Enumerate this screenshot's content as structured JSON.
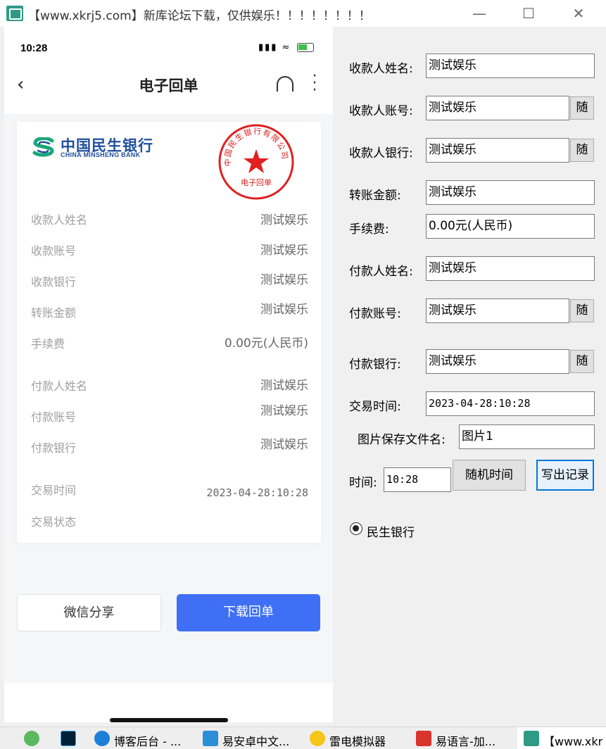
{
  "window": {
    "title": "【www.xkrj5.com】新库论坛下载，仅供娱乐！！！！！！！！",
    "minimize_icon": "minimize-icon",
    "maximize_icon": "maximize-icon",
    "close_icon": "close-icon"
  },
  "phone": {
    "status_time": "10:28",
    "page_title": "电子回单",
    "bank_name_cn": "中国民生银行",
    "bank_name_en": "CHINA MINSHENG BANK",
    "seal_text": "中国民生银行有限公司",
    "seal_subtext": "电子回单",
    "receipt_rows": [
      {
        "label": "收款人姓名",
        "value": "测试娱乐"
      },
      {
        "label": "收款账号",
        "value": "测试娱乐"
      },
      {
        "label": "收款银行",
        "value": "测试娱乐"
      },
      {
        "label": "转账金额",
        "value": "测试娱乐"
      },
      {
        "label": "手续费",
        "value": "0.00元(人民币)"
      },
      {
        "label": "付款人姓名",
        "value": "测试娱乐"
      },
      {
        "label": "付款账号",
        "value": "测试娱乐"
      },
      {
        "label": "付款银行",
        "value": "测试娱乐"
      },
      {
        "label": "交易时间",
        "value": "2023-04-28:10:28"
      },
      {
        "label": "交易状态",
        "value": ""
      }
    ],
    "share_button": "微信分享",
    "download_button": "下载回单"
  },
  "form": {
    "payee_name": {
      "label": "收款人姓名:",
      "value": "测试娱乐"
    },
    "payee_account": {
      "label": "收款人账号:",
      "value": "测试娱乐",
      "random": "随"
    },
    "payee_bank": {
      "label": "收款人银行:",
      "value": "测试娱乐",
      "random": "随"
    },
    "amount": {
      "label": "转账金额:",
      "value": "测试娱乐"
    },
    "fee": {
      "label": "手续费:",
      "value": "0.00元(人民币)"
    },
    "payer_name": {
      "label": "付款人姓名:",
      "value": "测试娱乐"
    },
    "payer_account": {
      "label": "付款账号:",
      "value": "测试娱乐",
      "random": "随"
    },
    "payer_bank": {
      "label": "付款银行:",
      "value": "测试娱乐",
      "random": "随"
    },
    "trade_time": {
      "label": "交易时间:",
      "value": "2023-04-28:10:28"
    },
    "image_filename": {
      "label": "图片保存文件名:",
      "value": "图片1"
    },
    "time": {
      "label": "时间:",
      "value": "10:28"
    },
    "random_time_button": "随机时间",
    "write_record_button": "写出记录",
    "bank_option": "民生银行"
  },
  "taskbar": {
    "items": [
      {
        "label": "",
        "icon": "browser-icon"
      },
      {
        "label": "",
        "icon": "photoshop-icon"
      },
      {
        "label": "博客后台 - ...",
        "icon": "edge-icon"
      },
      {
        "label": "易安卓中文...",
        "icon": "easy-android-icon"
      },
      {
        "label": "雷电模拟器",
        "icon": "ldplayer-icon"
      },
      {
        "label": "易语言-加...",
        "icon": "easy-language-icon"
      },
      {
        "label": "【www.xkr",
        "icon": "app-icon"
      }
    ]
  },
  "colors": {
    "bank_blue": "#1f4e9c",
    "bank_green": "#1aa67a",
    "seal_red": "#e02020",
    "download_blue": "#3e6ff4"
  }
}
